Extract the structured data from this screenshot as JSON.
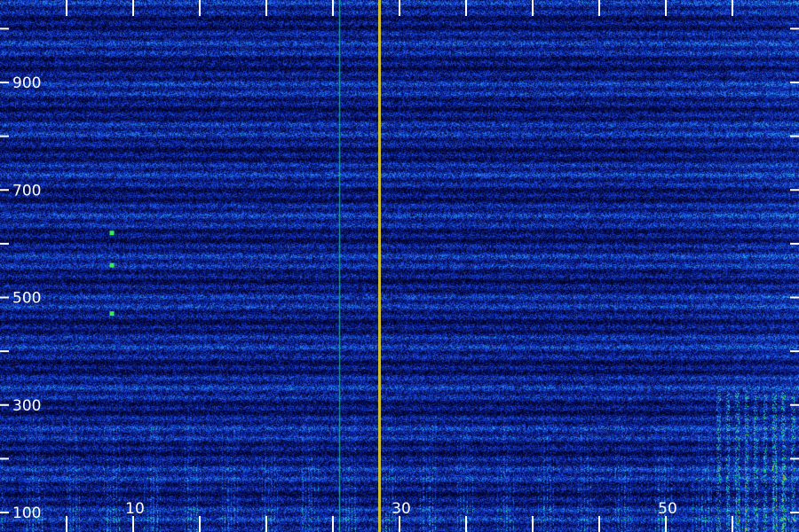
{
  "chart_data": {
    "type": "heatmap",
    "title": "",
    "xlabel": "",
    "ylabel": "",
    "xlim": [
      0,
      60
    ],
    "ylim": [
      100,
      1050
    ],
    "x_ticks": [
      0,
      5,
      10,
      15,
      20,
      25,
      30,
      35,
      40,
      45,
      50,
      55
    ],
    "x_tick_labels": [
      {
        "value": 10,
        "label": "10"
      },
      {
        "value": 30,
        "label": "30"
      },
      {
        "value": 50,
        "label": "50"
      }
    ],
    "y_ticks": [
      100,
      200,
      300,
      400,
      500,
      600,
      700,
      800,
      900,
      1000
    ],
    "y_tick_labels": [
      {
        "value": 100,
        "label": "100"
      },
      {
        "value": 300,
        "label": "300"
      },
      {
        "value": 500,
        "label": "500"
      },
      {
        "value": 700,
        "label": "700"
      },
      {
        "value": 900,
        "label": "900"
      }
    ],
    "background_noise": "uniform low intensity",
    "features": [
      {
        "kind": "vertical-line",
        "x": 28.5,
        "y_range": [
          100,
          1050
        ],
        "intensity": "high"
      },
      {
        "kind": "vertical-line",
        "x": 25.5,
        "y_range": [
          100,
          1000
        ],
        "intensity": "medium"
      },
      {
        "kind": "vertical-band",
        "x_range": [
          55,
          60
        ],
        "y_range": [
          100,
          1050
        ],
        "intensity": "medium"
      },
      {
        "kind": "low-frequency-bursts",
        "y_range": [
          100,
          330
        ],
        "intensity": "medium"
      },
      {
        "kind": "point",
        "x": 8.4,
        "y": 620,
        "intensity": "medium"
      },
      {
        "kind": "point",
        "x": 8.4,
        "y": 560,
        "intensity": "medium"
      },
      {
        "kind": "point",
        "x": 8.4,
        "y": 470,
        "intensity": "medium"
      }
    ],
    "colormap": [
      "#000020",
      "#0a1e8c",
      "#1a46e0",
      "#28b4e6",
      "#32f050",
      "#f0d020",
      "#e63c1e"
    ],
    "grid": false,
    "legend": "none"
  }
}
